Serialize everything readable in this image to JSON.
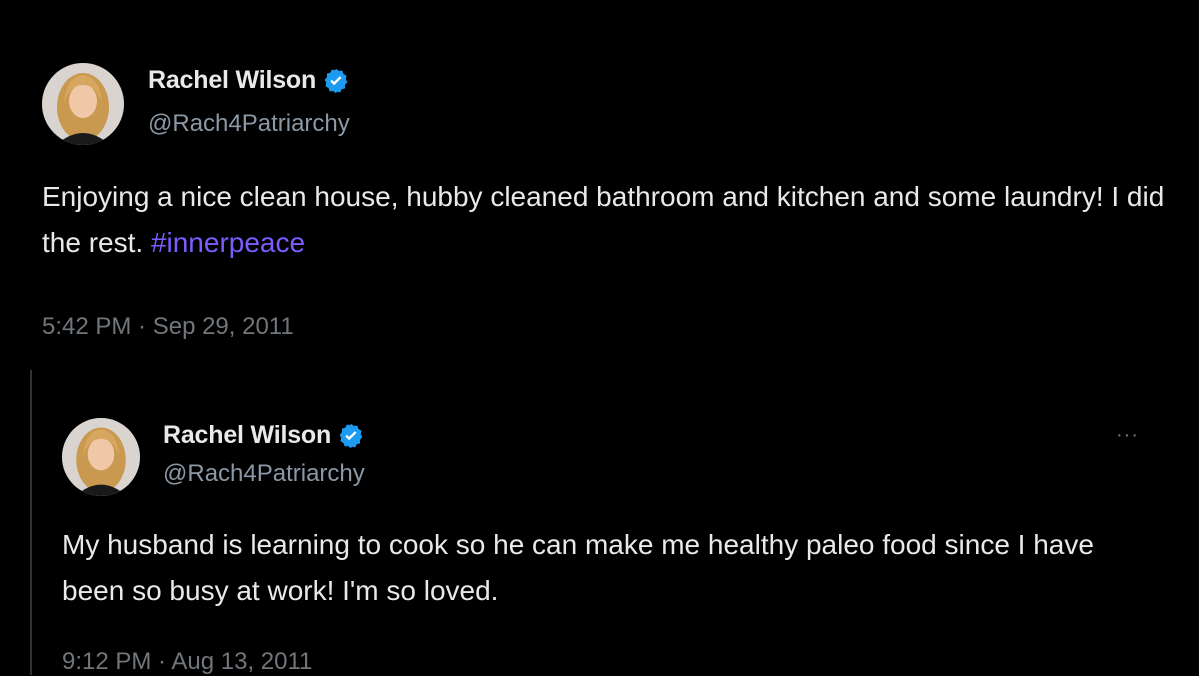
{
  "main_tweet": {
    "author": "Rachel Wilson",
    "handle": "@Rach4Patriarchy",
    "text_before": "Enjoying a nice clean house, hubby cleaned bathroom and kitchen and some laundry! I did the rest. ",
    "hashtag": "#innerpeace",
    "timestamp": "5:42 PM · Sep 29, 2011"
  },
  "quoted_tweet": {
    "author": "Rachel Wilson",
    "handle": "@Rach4Patriarchy",
    "text": "My husband is learning to cook so he can make me healthy paleo food since I have been so busy at work! I'm so loved.",
    "timestamp": "9:12 PM · Aug 13, 2011",
    "more_label": "···"
  },
  "colors": {
    "background": "#000000",
    "text": "#e7e9ea",
    "secondary": "#71767b",
    "hashtag": "#7d5cff",
    "verified": "#1d9bf0"
  },
  "icons": {
    "verified": "verified-badge-icon",
    "more": "more-options-icon"
  }
}
